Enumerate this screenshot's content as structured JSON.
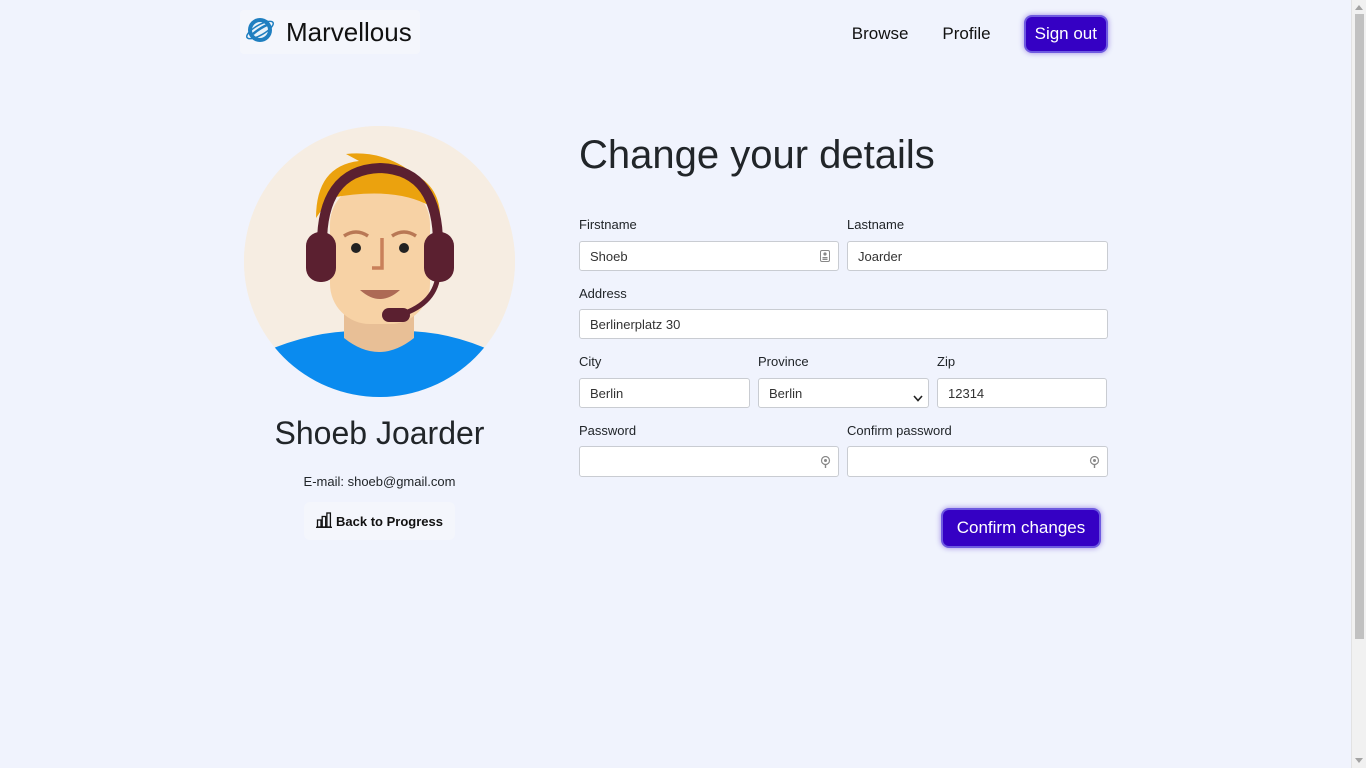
{
  "brand": {
    "name": "Marvellous"
  },
  "nav": {
    "browse": "Browse",
    "profile": "Profile",
    "signout": "Sign out"
  },
  "profile": {
    "full_name": "Shoeb Joarder",
    "email_line": "E-mail: shoeb@gmail.com",
    "back_button": "Back to Progress"
  },
  "form": {
    "heading": "Change your details",
    "firstname": {
      "label": "Firstname",
      "value": "Shoeb"
    },
    "lastname": {
      "label": "Lastname",
      "value": "Joarder"
    },
    "address": {
      "label": "Address",
      "value": "Berlinerplatz 30"
    },
    "city": {
      "label": "City",
      "value": "Berlin"
    },
    "province": {
      "label": "Province",
      "value": "Berlin"
    },
    "zip": {
      "label": "Zip",
      "value": "12314"
    },
    "password": {
      "label": "Password",
      "value": ""
    },
    "confirm_password": {
      "label": "Confirm password",
      "value": ""
    },
    "submit": "Confirm changes"
  },
  "colors": {
    "background": "#f0f3fd",
    "primary": "#3500c4",
    "avatar_bg": "#f6ede2",
    "shirt": "#0a8bef"
  },
  "icons": {
    "brand": "planet-logo-icon",
    "back": "bar-chart-icon",
    "firstname_field": "contact-card-icon",
    "password_field": "key-icon"
  }
}
